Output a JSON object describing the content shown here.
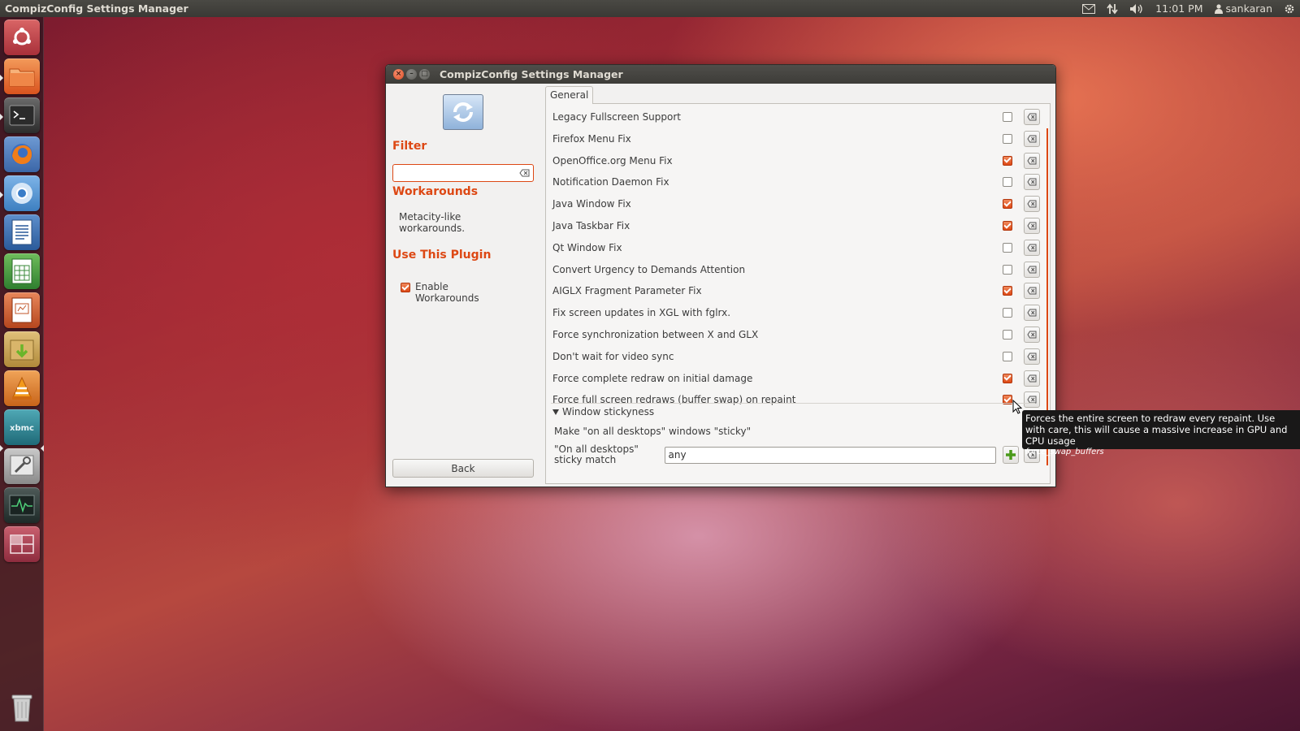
{
  "top_panel": {
    "app_title": "CompizConfig Settings Manager",
    "time": "11:01 PM",
    "user": "sankaran",
    "indicators": [
      "mail-icon",
      "network-icon",
      "volume-icon",
      "user-icon",
      "gear-icon"
    ]
  },
  "launcher": {
    "items": [
      {
        "name": "dash",
        "icon": "ubuntu-logo-icon",
        "color": "#c8474a"
      },
      {
        "name": "files",
        "icon": "folder-icon",
        "color": "#e8642c"
      },
      {
        "name": "terminal",
        "icon": "terminal-icon",
        "color": "#333333"
      },
      {
        "name": "firefox",
        "icon": "firefox-icon",
        "color": "#e06b1a"
      },
      {
        "name": "chromium",
        "icon": "chromium-icon",
        "color": "#3a86c8"
      },
      {
        "name": "writer",
        "icon": "writer-icon",
        "color": "#2a5c9a"
      },
      {
        "name": "calc",
        "icon": "calc-icon",
        "color": "#3a8a3a"
      },
      {
        "name": "impress",
        "icon": "impress-icon",
        "color": "#c0562a"
      },
      {
        "name": "archive-manager",
        "icon": "archive-icon",
        "color": "#c9a24a"
      },
      {
        "name": "vlc",
        "icon": "vlc-icon",
        "color": "#e07a16"
      },
      {
        "name": "xbmc",
        "icon": "xbmc-icon",
        "color": "#2a7a8a"
      },
      {
        "name": "ccsm",
        "icon": "settings-tools-icon",
        "color": "#8a8a8a"
      },
      {
        "name": "system-monitor",
        "icon": "system-monitor-icon",
        "color": "#2e3b3a"
      },
      {
        "name": "workspace-switcher",
        "icon": "workspace-icon",
        "color": "#b5485a"
      },
      {
        "name": "trash",
        "icon": "trash-icon",
        "color": "#9a9a9a"
      }
    ],
    "xbmc_label": "xbmc"
  },
  "window": {
    "title": "CompizConfig Settings Manager",
    "filter_label": "Filter",
    "filter_value": "",
    "plugin_name": "Workarounds",
    "plugin_description": "Metacity-like workarounds.",
    "use_plugin_label": "Use This Plugin",
    "enable_label": "Enable Workarounds",
    "enable_checked": true,
    "back_label": "Back",
    "tab_label": "General",
    "options": [
      {
        "label": "Legacy Fullscreen Support",
        "checked": false
      },
      {
        "label": "Firefox Menu Fix",
        "checked": false
      },
      {
        "label": "OpenOffice.org Menu Fix",
        "checked": true
      },
      {
        "label": "Notification Daemon Fix",
        "checked": false
      },
      {
        "label": "Java Window Fix",
        "checked": true
      },
      {
        "label": "Java Taskbar Fix",
        "checked": true
      },
      {
        "label": "Qt Window Fix",
        "checked": false
      },
      {
        "label": "Convert Urgency to Demands Attention",
        "checked": false
      },
      {
        "label": "AIGLX Fragment Parameter Fix",
        "checked": true
      },
      {
        "label": "Fix screen updates in XGL with fglrx.",
        "checked": false
      },
      {
        "label": "Force synchronization between X and GLX",
        "checked": false
      },
      {
        "label": "Don't wait for video sync",
        "checked": false
      },
      {
        "label": "Force complete redraw on initial damage",
        "checked": true
      },
      {
        "label": "Force full screen redraws (buffer swap) on repaint",
        "checked": true
      }
    ],
    "group_label": "Window stickyness",
    "sticky_label": "Make \"on all desktops\" windows \"sticky\"",
    "sticky_checked": false,
    "match_label": "\"On all desktops\" sticky match",
    "match_value": "any"
  },
  "tooltip": {
    "text": "Forces the entire screen to redraw every repaint. Use with care, this will cause a massive increase in GPU and CPU usage",
    "key": "force_swap_buffers"
  },
  "colors": {
    "accent": "#dd4814",
    "panel": "#3c3b37"
  }
}
